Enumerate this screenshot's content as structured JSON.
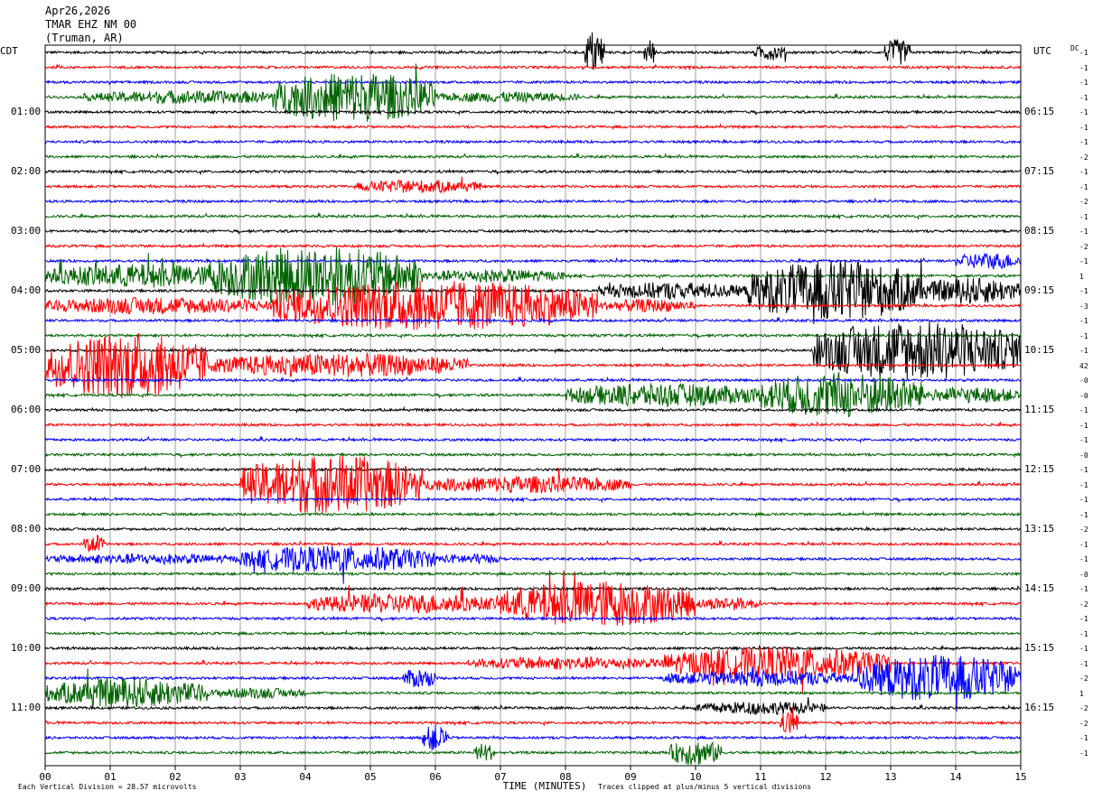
{
  "header": {
    "date": "Apr26,2026",
    "station": "TMAR EHZ NM 00",
    "location": "(Truman, AR)"
  },
  "axis": {
    "left_title": "CDT",
    "right_title": "UTC",
    "dc_title": "DC",
    "x_title": "TIME (MINUTES)",
    "footer_left": "Each Vertical Division =   28.57 microvolts",
    "footer_right": "Traces clipped at plus/minus 5 vertical divisions"
  },
  "colors": {
    "black": "#000000",
    "red": "#ff0000",
    "blue": "#0000ff",
    "green": "#006400",
    "grid": "#a0a0a0"
  },
  "chart_data": {
    "type": "line",
    "title": "TMAR EHZ NM 00",
    "xlabel": "TIME (MINUTES)",
    "ylabel": "",
    "xlim": [
      0,
      15
    ],
    "x_ticks": [
      "00",
      "01",
      "02",
      "03",
      "04",
      "05",
      "06",
      "07",
      "08",
      "09",
      "10",
      "11",
      "12",
      "13",
      "14",
      "15"
    ],
    "left_time_labels": [
      "01:00",
      "02:00",
      "03:00",
      "04:00",
      "05:00",
      "06:00",
      "07:00",
      "08:00",
      "09:00",
      "10:00",
      "11:00"
    ],
    "right_time_labels": [
      "06:15",
      "07:15",
      "08:15",
      "09:15",
      "10:15",
      "11:15",
      "12:15",
      "13:15",
      "14:15",
      "15:15",
      "16:15"
    ],
    "trace_colors": [
      "black",
      "red",
      "blue",
      "green"
    ],
    "trace_count": 48,
    "minutes_per_trace": 15,
    "dc_offsets": [
      "-1",
      "-1",
      "-1",
      "-1",
      "-1",
      "-1",
      "-1",
      "-2",
      "-1",
      "-1",
      "-2",
      "-1",
      "-1",
      "-2",
      "-1",
      "1",
      "-1",
      "-3",
      "-1",
      "-1",
      "-1",
      "42",
      "-0",
      "-0",
      "-1",
      "-1",
      "-1",
      "-0",
      "-1",
      "-1",
      "-1",
      "-1",
      "-2",
      "-1",
      "-1",
      "-0",
      "-1",
      "-2",
      "-1",
      "-1",
      "-1",
      "-1",
      "-2",
      "1",
      "-2",
      "-2",
      "-1",
      "-1"
    ],
    "events": [
      {
        "trace": 0,
        "start_min": 8.3,
        "end_min": 8.6,
        "amp": 3.5
      },
      {
        "trace": 0,
        "start_min": 9.2,
        "end_min": 9.4,
        "amp": 2.0
      },
      {
        "trace": 0,
        "start_min": 10.9,
        "end_min": 11.4,
        "amp": 1.2
      },
      {
        "trace": 0,
        "start_min": 12.9,
        "end_min": 13.3,
        "amp": 2.0
      },
      {
        "trace": 3,
        "start_min": 0.6,
        "end_min": 4.0,
        "amp": 1.0
      },
      {
        "trace": 3,
        "start_min": 3.5,
        "end_min": 6.0,
        "amp": 3.8
      },
      {
        "trace": 3,
        "start_min": 6.0,
        "end_min": 8.2,
        "amp": 0.8
      },
      {
        "trace": 9,
        "start_min": 4.8,
        "end_min": 6.7,
        "amp": 1.0
      },
      {
        "trace": 14,
        "start_min": 14.0,
        "end_min": 15.0,
        "amp": 1.3
      },
      {
        "trace": 15,
        "start_min": 0.0,
        "end_min": 3.0,
        "amp": 1.8
      },
      {
        "trace": 15,
        "start_min": 2.5,
        "end_min": 5.8,
        "amp": 4.5
      },
      {
        "trace": 15,
        "start_min": 5.8,
        "end_min": 8.0,
        "amp": 1.0
      },
      {
        "trace": 16,
        "start_min": 8.5,
        "end_min": 10.8,
        "amp": 1.3
      },
      {
        "trace": 16,
        "start_min": 10.8,
        "end_min": 13.5,
        "amp": 4.5
      },
      {
        "trace": 16,
        "start_min": 13.5,
        "end_min": 15.0,
        "amp": 2.0
      },
      {
        "trace": 17,
        "start_min": 0.0,
        "end_min": 3.5,
        "amp": 1.3
      },
      {
        "trace": 17,
        "start_min": 3.5,
        "end_min": 8.5,
        "amp": 3.8
      },
      {
        "trace": 17,
        "start_min": 8.5,
        "end_min": 10.0,
        "amp": 1.0
      },
      {
        "trace": 20,
        "start_min": 11.8,
        "end_min": 15.0,
        "amp": 4.5
      },
      {
        "trace": 21,
        "start_min": 0.0,
        "end_min": 2.5,
        "amp": 5.0
      },
      {
        "trace": 21,
        "start_min": 2.5,
        "end_min": 6.5,
        "amp": 1.8
      },
      {
        "trace": 23,
        "start_min": 8.0,
        "end_min": 11.0,
        "amp": 1.8
      },
      {
        "trace": 23,
        "start_min": 11.0,
        "end_min": 13.5,
        "amp": 3.5
      },
      {
        "trace": 23,
        "start_min": 13.5,
        "end_min": 15.0,
        "amp": 1.2
      },
      {
        "trace": 29,
        "start_min": 3.0,
        "end_min": 5.8,
        "amp": 4.5
      },
      {
        "trace": 29,
        "start_min": 5.8,
        "end_min": 9.0,
        "amp": 1.3
      },
      {
        "trace": 33,
        "start_min": 0.6,
        "end_min": 0.9,
        "amp": 1.5
      },
      {
        "trace": 34,
        "start_min": 0.0,
        "end_min": 3.0,
        "amp": 0.8
      },
      {
        "trace": 34,
        "start_min": 3.0,
        "end_min": 6.0,
        "amp": 2.0
      },
      {
        "trace": 34,
        "start_min": 6.0,
        "end_min": 7.0,
        "amp": 0.8
      },
      {
        "trace": 37,
        "start_min": 4.0,
        "end_min": 7.0,
        "amp": 1.5
      },
      {
        "trace": 37,
        "start_min": 7.0,
        "end_min": 10.0,
        "amp": 3.5
      },
      {
        "trace": 37,
        "start_min": 10.0,
        "end_min": 11.0,
        "amp": 1.0
      },
      {
        "trace": 41,
        "start_min": 6.5,
        "end_min": 9.5,
        "amp": 1.0
      },
      {
        "trace": 41,
        "start_min": 9.5,
        "end_min": 13.0,
        "amp": 2.5
      },
      {
        "trace": 42,
        "start_min": 5.5,
        "end_min": 6.0,
        "amp": 1.5
      },
      {
        "trace": 42,
        "start_min": 9.5,
        "end_min": 12.5,
        "amp": 1.2
      },
      {
        "trace": 42,
        "start_min": 12.5,
        "end_min": 15.0,
        "amp": 3.5
      },
      {
        "trace": 43,
        "start_min": 0.0,
        "end_min": 2.5,
        "amp": 2.2
      },
      {
        "trace": 43,
        "start_min": 2.5,
        "end_min": 4.0,
        "amp": 0.8
      },
      {
        "trace": 44,
        "start_min": 10.0,
        "end_min": 12.0,
        "amp": 1.0
      },
      {
        "trace": 45,
        "start_min": 11.3,
        "end_min": 11.6,
        "amp": 1.8
      },
      {
        "trace": 46,
        "start_min": 5.8,
        "end_min": 6.2,
        "amp": 2.0
      },
      {
        "trace": 47,
        "start_min": 6.6,
        "end_min": 6.9,
        "amp": 1.5
      },
      {
        "trace": 47,
        "start_min": 9.6,
        "end_min": 10.4,
        "amp": 2.0
      }
    ]
  }
}
